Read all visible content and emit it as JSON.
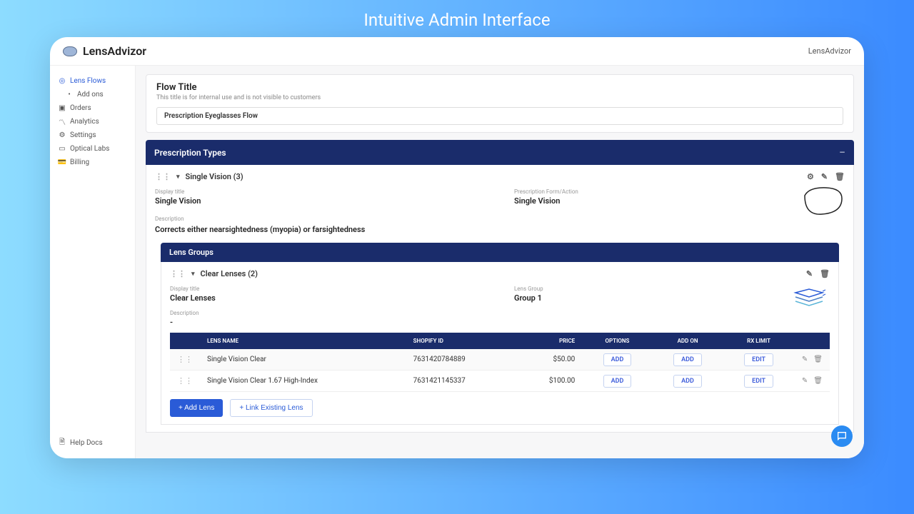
{
  "hero": {
    "title": "Intuitive Admin Interface"
  },
  "brand": {
    "name": "LensAdvizor"
  },
  "topbar": {
    "right": "LensAdvizor"
  },
  "sidebar": {
    "items": [
      {
        "label": "Lens Flows",
        "active": true
      },
      {
        "label": "Add ons",
        "indent": true
      },
      {
        "label": "Orders"
      },
      {
        "label": "Analytics"
      },
      {
        "label": "Settings"
      },
      {
        "label": "Optical Labs"
      },
      {
        "label": "Billing"
      }
    ],
    "footer": {
      "label": "Help Docs"
    }
  },
  "flow": {
    "title_label": "Flow Title",
    "subtitle": "This title is for internal use and is not visible to customers",
    "value": "Prescription Eyeglasses Flow"
  },
  "prescription_types": {
    "header": "Prescription Types",
    "item": {
      "title": "Single Vision (3)",
      "display_title_label": "Display title",
      "display_title": "Single Vision",
      "form_label": "Prescription Form/Action",
      "form_value": "Single Vision",
      "desc_label": "Description",
      "desc_value": "Corrects either nearsightedness (myopia) or farsightedness"
    }
  },
  "lens_groups": {
    "header": "Lens Groups",
    "item": {
      "title": "Clear Lenses (2)",
      "display_title_label": "Display title",
      "display_title": "Clear Lenses",
      "group_label": "Lens Group",
      "group_value": "Group 1",
      "desc_label": "Description",
      "desc_value": "-"
    }
  },
  "table": {
    "columns": {
      "name": "LENS NAME",
      "shopify": "SHOPIFY ID",
      "price": "PRICE",
      "options": "OPTIONS",
      "addon": "ADD ON",
      "rxlimit": "RX LIMIT"
    },
    "rows": [
      {
        "name": "Single Vision Clear",
        "shopify": "7631420784889",
        "price": "$50.00",
        "options": "ADD",
        "addon": "ADD",
        "rxlimit": "EDIT"
      },
      {
        "name": "Single Vision Clear 1.67 High-Index",
        "shopify": "7631421145337",
        "price": "$100.00",
        "options": "ADD",
        "addon": "ADD",
        "rxlimit": "EDIT"
      }
    ]
  },
  "buttons": {
    "add_lens": "+ Add Lens",
    "link_existing": "+ Link Existing Lens"
  }
}
